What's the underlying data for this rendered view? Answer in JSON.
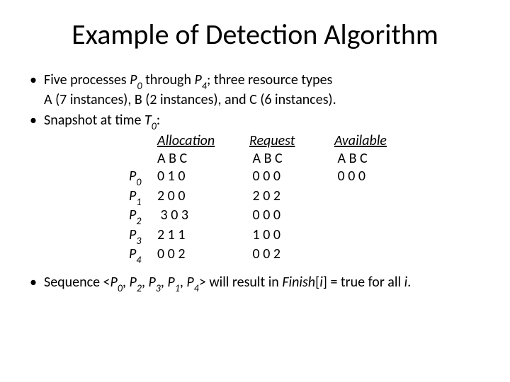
{
  "title": "Example of Detection Algorithm",
  "bullet1": {
    "pre": "Five processes ",
    "p0": "P",
    "p0s": "0",
    "mid1": " through ",
    "p4": "P",
    "p4s": "4",
    "mid2": "; three resource types",
    "line2": "A (7 instances), B (2 instances), and C (6 instances)."
  },
  "bullet2": {
    "pre": "Snapshot at time ",
    "t": "T",
    "ts": "0",
    "post": ":"
  },
  "headers": {
    "alloc": "Allocation",
    "req": "Request",
    "avail": "Available"
  },
  "abc": "A B C",
  "procs": [
    {
      "label": "P",
      "sub": "0",
      "alloc": "0 1 0",
      "req": "0 0 0",
      "avail": "0 0 0"
    },
    {
      "label": "P",
      "sub": "1",
      "alloc": "2 0 0",
      "req": "2 0 2",
      "avail": ""
    },
    {
      "label": "P",
      "sub": "2",
      "alloc": "3 0 3",
      "req": "0 0 0",
      "avail": ""
    },
    {
      "label": "P",
      "sub": "3",
      "alloc": "2 1 1",
      "req": "1 0 0",
      "avail": ""
    },
    {
      "label": "P",
      "sub": "4",
      "alloc": "0 0 2",
      "req": "0 0 2",
      "avail": ""
    }
  ],
  "bullet3": {
    "pre": "Sequence <",
    "seq": [
      {
        "l": "P",
        "s": "0"
      },
      {
        "l": "P",
        "s": "2"
      },
      {
        "l": "P",
        "s": "3"
      },
      {
        "l": "P",
        "s": "1"
      },
      {
        "l": "P",
        "s": "4"
      }
    ],
    "sep": ", ",
    "post1": "> will result in ",
    "finish": "Finish",
    "post2": "[",
    "i": "i",
    "post3": "] = true for all ",
    "i2": "i",
    "post4": "."
  }
}
